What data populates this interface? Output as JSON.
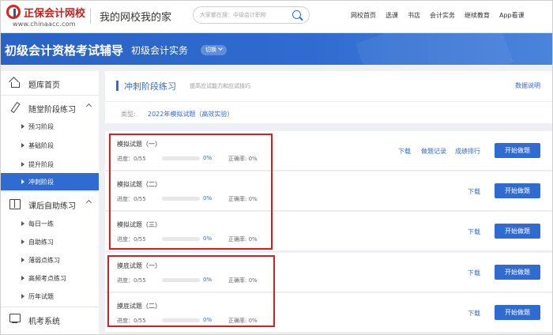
{
  "header": {
    "logo_brand": "正保会计网校",
    "logo_url": "www.chinaacc.com",
    "site_title": "我的网校我的家",
    "search_placeholder": "大家都在搜：中级会计职称",
    "nav": [
      "网校首页",
      "选课",
      "书店",
      "会计实务",
      "继续教育",
      "App看课"
    ]
  },
  "banner": {
    "title": "初级会计资格考试辅导",
    "subject": "初级会计实务",
    "switch_label": "切换"
  },
  "sidebar": {
    "groups": [
      {
        "label": "题库首页",
        "icon": "home-icon",
        "items": []
      },
      {
        "label": "随堂阶段练习",
        "icon": "pen-icon",
        "expanded": true,
        "items": [
          "预习阶段",
          "基础阶段",
          "提升阶段",
          "冲刺阶段"
        ],
        "active": "冲刺阶段"
      },
      {
        "label": "课后自助练习",
        "icon": "book-icon",
        "expanded": true,
        "items": [
          "每日一练",
          "自助练习",
          "薄弱点练习",
          "高频考点练习",
          "历年试题"
        ]
      },
      {
        "label": "机考系统",
        "icon": "monitor-icon",
        "items": []
      }
    ]
  },
  "section": {
    "title": "冲刺阶段练习",
    "subtitle": "提高应试能力和应试技巧",
    "help": "数据说明",
    "filter_key": "类型:",
    "filter_value": "2022年模拟试题（高效实验）"
  },
  "papers": [
    {
      "name": "模拟试题（一）",
      "progress_label": "进度：0/55",
      "progress": 0,
      "percent": "0%",
      "accuracy": "正确率: 0%",
      "links": [
        "下载",
        "做题记录",
        "成绩排行"
      ],
      "button": "开始做题"
    },
    {
      "name": "模拟试题（二）",
      "progress_label": "进度：0/55",
      "progress": 0,
      "percent": "0%",
      "accuracy": "正确率: 0%",
      "links": [
        "下载"
      ],
      "button": "开始做题"
    },
    {
      "name": "模拟试题（三）",
      "progress_label": "进度：0/55",
      "progress": 0,
      "percent": "0%",
      "accuracy": "正确率: 0%",
      "links": [
        "下载"
      ],
      "button": "开始做题"
    },
    {
      "name": "摸底试题（一）",
      "progress_label": "进度：0/55",
      "progress": 0,
      "percent": "0%",
      "accuracy": "正确率: 0%",
      "links": [
        "下载"
      ],
      "button": "开始做题"
    },
    {
      "name": "摸底试题（二）",
      "progress_label": "进度：0/55",
      "progress": 0,
      "percent": "0%",
      "accuracy": "正确率: 0%",
      "links": [
        "下载"
      ],
      "button": "开始做题"
    }
  ],
  "colors": {
    "accent": "#2f6bd0",
    "highlight": "#e01b1b"
  }
}
